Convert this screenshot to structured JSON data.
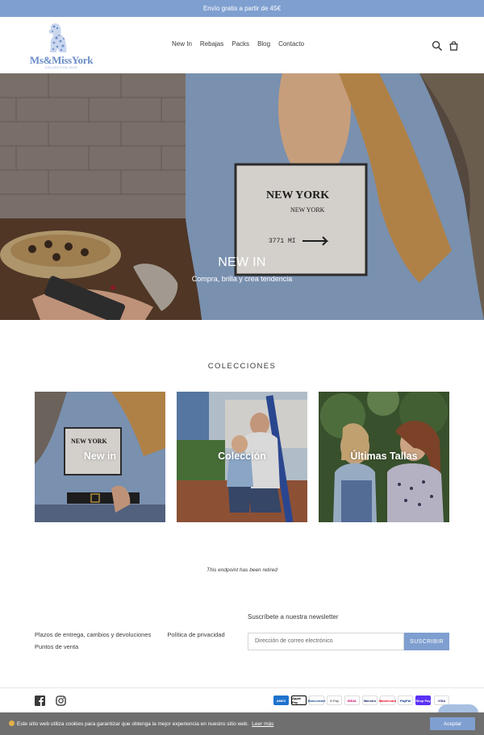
{
  "announcement": "Envío gratis a partir de 45€",
  "logo": {
    "name": "Ms&MissYork",
    "tagline": "COLLECTION 2016"
  },
  "nav": [
    "New In",
    "Rebajas",
    "Packs",
    "Blog",
    "Contacto"
  ],
  "header_icons": [
    "search-icon",
    "cart-icon"
  ],
  "hero": {
    "title": "NEW IN",
    "subtitle": "Compra, brilla y crea tendencia",
    "shirt_lines": [
      "NEW YORK",
      "NEW YORK",
      "3771  MI"
    ]
  },
  "collections": {
    "title": "COLECCIONES",
    "items": [
      {
        "label": "New in",
        "shirt_text": "NEW YORK"
      },
      {
        "label": "Colección"
      },
      {
        "label": "Últimas Tallas"
      }
    ]
  },
  "retired_notice": "This endpoint has been retired",
  "footer": {
    "links": [
      "Plazos de entrega, cambios y devoluciones",
      "Política de privacidad",
      "Puntos de venta"
    ],
    "newsletter": {
      "title": "Suscríbete a nuestra newsletter",
      "placeholder": "Dirección de correo electrónico",
      "button": "SUSCRIBIR"
    },
    "social": [
      "facebook-icon",
      "instagram-icon"
    ],
    "payments": [
      "AMEX",
      "Apple Pay",
      "Bancontact",
      "G Pay",
      "iDEAL",
      "Maestro",
      "Mastercard",
      "PayPal",
      "Shop Pay",
      "VISA"
    ]
  },
  "cookie": {
    "text": "Este sitio web utiliza cookies para garantizar que obtenga la mejor experiencia en nuestro sitio web.",
    "link": "Leer más",
    "button": "Aceptar"
  },
  "colors": {
    "accent": "#7f9fd0",
    "cookie_bar": "#6f6f6f",
    "text": "#3a3a3a"
  }
}
